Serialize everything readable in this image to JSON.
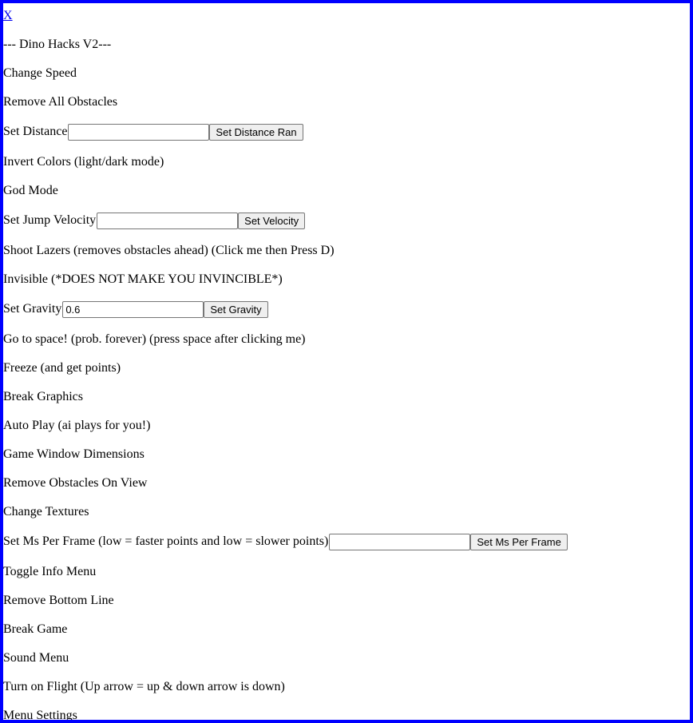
{
  "menu": {
    "close_label": "X",
    "title": "--- Dino Hacks V2---",
    "items": {
      "change_speed": "Change Speed",
      "remove_all_obstacles": "Remove All Obstacles",
      "set_distance": {
        "label": "Set Distance ",
        "value": "",
        "button": "Set Distance Ran"
      },
      "invert_colors": "Invert Colors (light/dark mode)",
      "god_mode": "God Mode",
      "set_jump_velocity": {
        "label": "Set Jump Velocity ",
        "value": "",
        "button": "Set Velocity"
      },
      "shoot_lazers": "Shoot Lazers (removes obstacles ahead) (Click me then Press D)",
      "invisible": "Invisible (*DOES NOT MAKE YOU INVINCIBLE*)",
      "set_gravity": {
        "label": "Set Gravity ",
        "value": "0.6",
        "button": "Set Gravity"
      },
      "go_to_space": "Go to space! (prob. forever) (press space after clicking me)",
      "freeze": "Freeze (and get points)",
      "break_graphics": "Break Graphics",
      "auto_play": "Auto Play (ai plays for you!)",
      "game_window_dimensions": "Game Window Dimensions",
      "remove_obstacles_on_view": "Remove Obstacles On View",
      "change_textures": "Change Textures",
      "set_ms_per_frame": {
        "label": "Set Ms Per Frame (low = faster points and low = slower points)",
        "value": "",
        "button": "Set Ms Per Frame"
      },
      "toggle_info_menu": "Toggle Info Menu",
      "remove_bottom_line": "Remove Bottom Line",
      "break_game": "Break Game",
      "sound_menu": "Sound Menu",
      "turn_on_flight": "Turn on Flight (Up arrow = up & down arrow is down)",
      "menu_settings": "Menu Settings"
    }
  },
  "colors": {
    "border": "#0000ff",
    "link": "#0000ee",
    "button_bg": "#efefef",
    "input_border": "#767676"
  }
}
